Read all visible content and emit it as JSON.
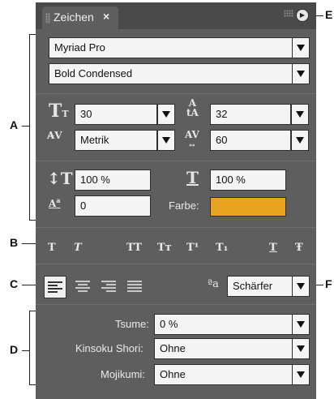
{
  "panel": {
    "tab_label": "Zeichen",
    "tab_close": "×",
    "menu_icon": "▶",
    "font_family": "Myriad Pro",
    "font_style": "Bold Condensed",
    "font_size": "30",
    "leading": "32",
    "kerning": "Metrik",
    "tracking": "60",
    "vertical_scale": "100 %",
    "horizontal_scale": "100 %",
    "baseline_shift": "0",
    "color_label": "Farbe:",
    "color_value": "#e8a321",
    "format_buttons": [
      "T",
      "T",
      "TT",
      "Tт",
      "T¹",
      "T₁",
      "T",
      "Ŧ"
    ],
    "antialias_icon": "ªa",
    "antialias_value": "Schärfer",
    "tsume_label": "Tsume:",
    "tsume_value": "0 %",
    "kinsoku_label": "Kinsoku Shori:",
    "kinsoku_value": "Ohne",
    "mojikumi_label": "Mojikumi:",
    "mojikumi_value": "Ohne"
  },
  "callouts": {
    "a": "A",
    "b": "B",
    "c": "C",
    "d": "D",
    "e": "E",
    "f": "F"
  }
}
